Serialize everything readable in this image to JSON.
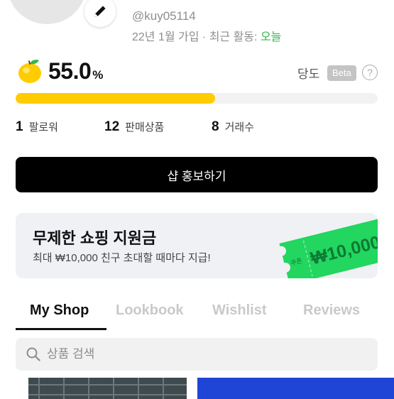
{
  "profile": {
    "username": "@kuy05114",
    "joined": "22년 1월 가입",
    "separator": "·",
    "activity_label": "최근 활동:",
    "activity_value": "오늘"
  },
  "rating": {
    "score": "55.0",
    "unit": "%",
    "fill_fraction": 0.55,
    "label": "당도",
    "badge": "Beta",
    "help": "?",
    "colors": {
      "bar": "#ffcc00",
      "track": "#f2f2f2"
    }
  },
  "stats": [
    {
      "count": "1",
      "label": "팔로워"
    },
    {
      "count": "12",
      "label": "판매상품"
    },
    {
      "count": "8",
      "label": "거래수"
    }
  ],
  "promote_button": "샵 홍보하기",
  "banner": {
    "title": "무제한 쇼핑 지원금",
    "subtitle": "최대 ₩10,000 친구 초대할 때마다 지급!",
    "coupon_tag": "쿠폰",
    "coupon_value": "₩10,000",
    "coupon_color": "#22d65f"
  },
  "tabs": [
    {
      "label": "My Shop",
      "active": true
    },
    {
      "label": "Lookbook",
      "active": false
    },
    {
      "label": "Wishlist",
      "active": false
    },
    {
      "label": "Reviews",
      "active": false
    }
  ],
  "search": {
    "placeholder": "상품 검색",
    "value": ""
  },
  "icons": {
    "edit": "pencil-icon",
    "rating": "lemon-icon",
    "help": "question-circle-icon",
    "search": "search-icon"
  },
  "colors": {
    "accent_green": "#2fb84a",
    "black": "#000000"
  }
}
